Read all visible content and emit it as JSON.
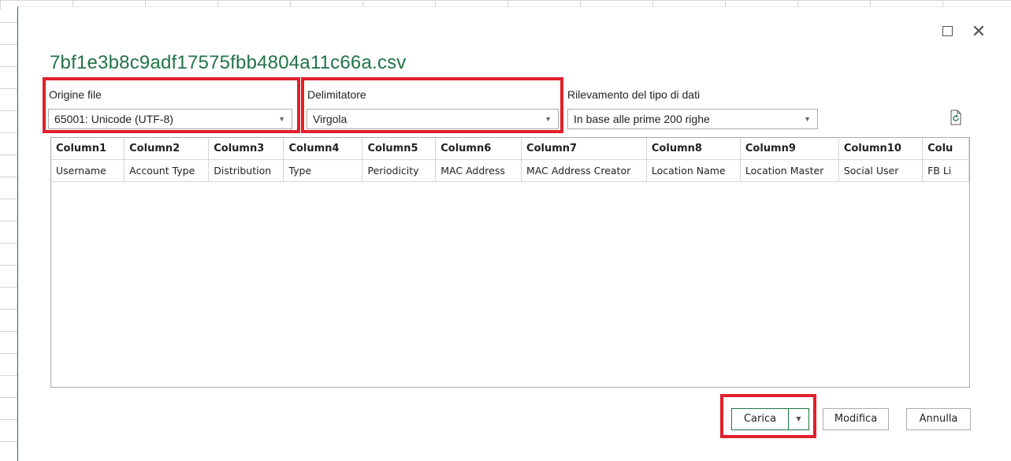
{
  "dialog": {
    "file_name": "7bf1e3b8c9adf17575fbb4804a11c66a.csv",
    "maximize_icon": "maximize-icon",
    "close_icon": "close-icon",
    "close_glyph": "✕"
  },
  "file_origin": {
    "label": "Origine file",
    "value": "65001: Unicode (UTF-8)"
  },
  "delimiter": {
    "label": "Delimitatore",
    "value": "Virgola"
  },
  "data_type_detection": {
    "label": "Rilevamento del tipo di dati",
    "value": "In base alle prime 200 righe"
  },
  "preview": {
    "headers": [
      "Column1",
      "Column2",
      "Column3",
      "Column4",
      "Column5",
      "Column6",
      "Column7",
      "Column8",
      "Column9",
      "Column10",
      "Colu"
    ],
    "rows": [
      [
        "Username",
        "Account Type",
        "Distribution",
        "Type",
        "Periodicity",
        "MAC Address",
        "MAC Address Creator",
        "Location Name",
        "Location Master",
        "Social User",
        "FB Li"
      ]
    ]
  },
  "buttons": {
    "load": "Carica",
    "load_dropdown_glyph": "▼",
    "edit": "Modifica",
    "cancel": "Annulla"
  },
  "colors": {
    "accent": "#217346",
    "highlight": "#e0202a"
  }
}
